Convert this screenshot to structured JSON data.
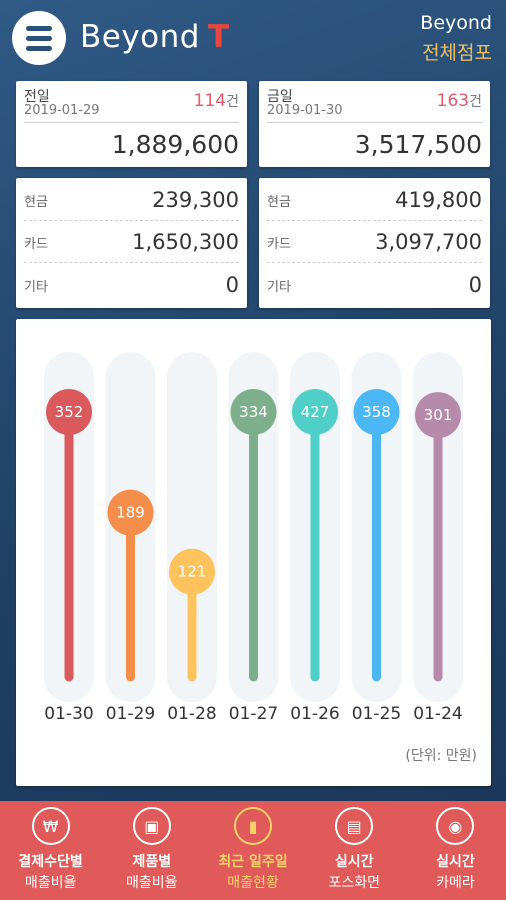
{
  "header": {
    "logo_text": "Beyond",
    "logo_accent": "T",
    "brand_name": "Beyond",
    "store_name": "전체점포"
  },
  "summary": [
    {
      "label": "전일",
      "date": "2019-01-29",
      "count": "114",
      "count_unit": "건",
      "amount": "1,889,600"
    },
    {
      "label": "금일",
      "date": "2019-01-30",
      "count": "163",
      "count_unit": "건",
      "amount": "3,517,500"
    }
  ],
  "payments": [
    [
      {
        "label": "현금",
        "value": "239,300"
      },
      {
        "label": "카드",
        "value": "1,650,300"
      },
      {
        "label": "기타",
        "value": "0"
      }
    ],
    [
      {
        "label": "현금",
        "value": "419,800"
      },
      {
        "label": "카드",
        "value": "3,097,700"
      },
      {
        "label": "기타",
        "value": "0"
      }
    ]
  ],
  "chart_data": {
    "type": "bar",
    "categories": [
      "01-30",
      "01-29",
      "01-28",
      "01-27",
      "01-26",
      "01-25",
      "01-24"
    ],
    "values": [
      352,
      189,
      121,
      334,
      427,
      358,
      301
    ],
    "colors": [
      "#d9595d",
      "#f58d4b",
      "#ffc35e",
      "#7daf8c",
      "#4fcfc7",
      "#4cb7f5",
      "#b58aaa"
    ],
    "ylim": [
      0,
      500
    ],
    "unit_note": "(단위: 만원)"
  },
  "bottom_nav": [
    {
      "icon": "wallet-icon",
      "glyph": "₩",
      "line1": "결제수단별",
      "line2": "매출비율",
      "active": false
    },
    {
      "icon": "box-icon",
      "glyph": "▣",
      "line1": "제품별",
      "line2": "매출비율",
      "active": false
    },
    {
      "icon": "bar-chart-icon",
      "glyph": "▮",
      "line1": "최근 일주일",
      "line2": "매출현황",
      "active": true
    },
    {
      "icon": "pos-register-icon",
      "glyph": "▤",
      "line1": "실시간",
      "line2": "포스화면",
      "active": false
    },
    {
      "icon": "camera-icon",
      "glyph": "◉",
      "line1": "실시간",
      "line2": "카메라",
      "active": false
    }
  ],
  "colors": {
    "accent": "#e8473f",
    "store": "#f0c060",
    "nav_bg": "#df5a58",
    "nav_active": "#f6d36a"
  }
}
